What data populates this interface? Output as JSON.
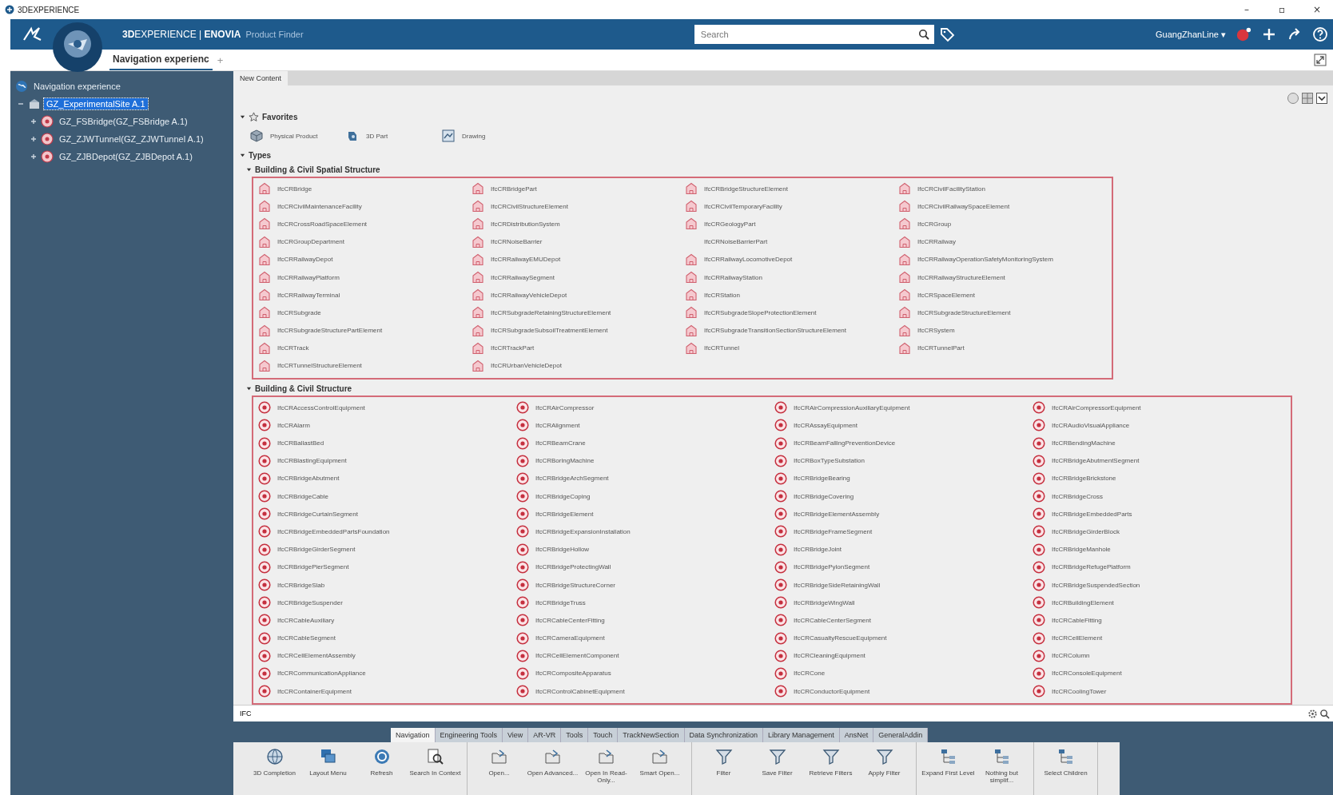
{
  "window": {
    "title": "3DEXPERIENCE",
    "controls": [
      "–",
      "▫",
      "×"
    ]
  },
  "header": {
    "brand": "**3D**EXPERIENCE | **ENOVIA**",
    "app": "Product Finder",
    "search": {
      "placeholder": "Search"
    },
    "user": "GuangZhanLine",
    "user_caret": "▾"
  },
  "tabs": [
    {
      "label": "Navigation experienc",
      "selected": true
    }
  ],
  "add_tab": "+",
  "tree": {
    "label": "Navigation experience",
    "children": [
      {
        "label": "GZ_ExperimentalSite A.1",
        "selected": true,
        "expanded": true,
        "children": [
          {
            "label": "GZ_FSBridge(GZ_FSBridge A.1)",
            "selected": false
          },
          {
            "label": "GZ_ZJWTunnel(GZ_ZJWTunnel A.1)",
            "selected": false
          },
          {
            "label": "GZ_ZJBDepot(GZ_ZJBDepot A.1)",
            "selected": false
          }
        ]
      }
    ]
  },
  "content_tab": "New Content",
  "favorites": {
    "title": "Favorites",
    "expanded": true,
    "items": [
      {
        "label": "Physical Product",
        "kind": "product"
      },
      {
        "label": "3D Part",
        "kind": "part"
      },
      {
        "label": "Drawing",
        "kind": "drawing"
      }
    ]
  },
  "types": {
    "title": "Types",
    "expanded": true,
    "sections": [
      {
        "title": "Building & Civil Spatial Structure",
        "kind": "spatial",
        "expanded": true,
        "items": [
          {
            "label": "IfcCRBridge",
            "icon": true
          },
          {
            "label": "IfcCRBridgePart",
            "icon": true
          },
          {
            "label": "IfcCRBridgeStructureElement",
            "icon": true
          },
          {
            "label": "IfcCRCivilFacilityStation",
            "icon": true
          },
          {
            "label": "IfcCRCivilMaintenanceFacility",
            "icon": true
          },
          {
            "label": "IfcCRCivilStructureElement",
            "icon": true
          },
          {
            "label": "IfcCRCivilTemporaryFacility",
            "icon": true
          },
          {
            "label": "IfcCRCivilRailwaySpaceElement",
            "icon": true
          },
          {
            "label": "IfcCRCrossRoadSpaceElement",
            "icon": true
          },
          {
            "label": "IfcCRDistributionSystem",
            "icon": true
          },
          {
            "label": "IfcCRGeologyPart",
            "icon": true
          },
          {
            "label": "IfcCRGroup",
            "icon": true
          },
          {
            "label": "IfcCRGroupDepartment",
            "icon": true
          },
          {
            "label": "IfcCRNoiseBarrier",
            "icon": true
          },
          {
            "label": "IfcCRNoiseBarrierPart",
            "icon": false
          },
          {
            "label": "IfcCRRailway",
            "icon": true
          },
          {
            "label": "IfcCRRailwayDepot",
            "icon": true
          },
          {
            "label": "IfcCRRailwayEMUDepot",
            "icon": true
          },
          {
            "label": "IfcCRRailwayLocomotiveDepot",
            "icon": true
          },
          {
            "label": "IfcCRRailwayOperationSafetyMonitoringSystem",
            "icon": true
          },
          {
            "label": "IfcCRRailwayPlatform",
            "icon": true
          },
          {
            "label": "IfcCRRailwaySegment",
            "icon": true
          },
          {
            "label": "IfcCRRailwayStation",
            "icon": true
          },
          {
            "label": "IfcCRRailwayStructureElement",
            "icon": true
          },
          {
            "label": "IfcCRRailwayTerminal",
            "icon": true
          },
          {
            "label": "IfcCRRailwayVehicleDepot",
            "icon": true
          },
          {
            "label": "IfcCRStation",
            "icon": true
          },
          {
            "label": "IfcCRSpaceElement",
            "icon": true
          },
          {
            "label": "IfcCRSubgrade",
            "icon": true
          },
          {
            "label": "IfcCRSubgradeRetainingStructureElement",
            "icon": true
          },
          {
            "label": "IfcCRSubgradeSlopeProtectionElement",
            "icon": true
          },
          {
            "label": "IfcCRSubgradeStructureElement",
            "icon": true
          },
          {
            "label": "IfcCRSubgradeStructurePartElement",
            "icon": true
          },
          {
            "label": "IfcCRSubgradeSubsoilTreatmentElement",
            "icon": true
          },
          {
            "label": "IfcCRSubgradeTransitionSectionStructureElement",
            "icon": true
          },
          {
            "label": "IfcCRSystem",
            "icon": true
          },
          {
            "label": "IfcCRTrack",
            "icon": true
          },
          {
            "label": "IfcCRTrackPart",
            "icon": true
          },
          {
            "label": "IfcCRTunnel",
            "icon": true
          },
          {
            "label": "IfcCRTunnelPart",
            "icon": true
          },
          {
            "label": "IfcCRTunnelStructureElement",
            "icon": true
          },
          {
            "label": "IfcCRUrbanVehicleDepot",
            "icon": true
          }
        ]
      },
      {
        "title": "Building & Civil Structure",
        "kind": "structure",
        "expanded": true,
        "items": [
          {
            "label": "IfcCRAccessControlEquipment",
            "icon": true
          },
          {
            "label": "IfcCRAirCompressor",
            "icon": true
          },
          {
            "label": "IfcCRAirCompressionAuxiliaryEquipment",
            "icon": true
          },
          {
            "label": "IfcCRAirCompressorEquipment",
            "icon": true
          },
          {
            "label": "IfcCRAlarm",
            "icon": true
          },
          {
            "label": "IfcCRAlignment",
            "icon": true
          },
          {
            "label": "IfcCRAssayEquipment",
            "icon": true
          },
          {
            "label": "IfcCRAudioVisualAppliance",
            "icon": true
          },
          {
            "label": "IfcCRBallastBed",
            "icon": true
          },
          {
            "label": "IfcCRBeamCrane",
            "icon": true
          },
          {
            "label": "IfcCRBeamFallingPreventionDevice",
            "icon": true
          },
          {
            "label": "IfcCRBendingMachine",
            "icon": true
          },
          {
            "label": "IfcCRBlastingEquipment",
            "icon": true
          },
          {
            "label": "IfcCRBoringMachine",
            "icon": true
          },
          {
            "label": "IfcCRBoxTypeSubstation",
            "icon": true
          },
          {
            "label": "IfcCRBridgeAbutmentSegment",
            "icon": true
          },
          {
            "label": "IfcCRBridgeAbutment",
            "icon": true
          },
          {
            "label": "IfcCRBridgeArchSegment",
            "icon": true
          },
          {
            "label": "IfcCRBridgeBearing",
            "icon": true
          },
          {
            "label": "IfcCRBridgeBrickstone",
            "icon": true
          },
          {
            "label": "IfcCRBridgeCable",
            "icon": true
          },
          {
            "label": "IfcCRBridgeCoping",
            "icon": true
          },
          {
            "label": "IfcCRBridgeCovering",
            "icon": true
          },
          {
            "label": "IfcCRBridgeCross",
            "icon": true
          },
          {
            "label": "IfcCRBridgeCurtainSegment",
            "icon": true
          },
          {
            "label": "IfcCRBridgeElement",
            "icon": true
          },
          {
            "label": "IfcCRBridgeElementAssembly",
            "icon": true
          },
          {
            "label": "IfcCRBridgeEmbeddedParts",
            "icon": true
          },
          {
            "label": "IfcCRBridgeEmbeddedPartsFoundation",
            "icon": true
          },
          {
            "label": "IfcCRBridgeExpansionInstallation",
            "icon": true
          },
          {
            "label": "IfcCRBridgeFrameSegment",
            "icon": true
          },
          {
            "label": "IfcCRBridgeGirderBlock",
            "icon": true
          },
          {
            "label": "IfcCRBridgeGirderSegment",
            "icon": true
          },
          {
            "label": "IfcCRBridgeHollow",
            "icon": true
          },
          {
            "label": "IfcCRBridgeJoint",
            "icon": true
          },
          {
            "label": "IfcCRBridgeManhole",
            "icon": true
          },
          {
            "label": "IfcCRBridgePierSegment",
            "icon": true
          },
          {
            "label": "IfcCRBridgeProtectingWall",
            "icon": true
          },
          {
            "label": "IfcCRBridgePylonSegment",
            "icon": true
          },
          {
            "label": "IfcCRBridgeRefugePlatform",
            "icon": true
          },
          {
            "label": "IfcCRBridgeSlab",
            "icon": true
          },
          {
            "label": "IfcCRBridgeStructureCorner",
            "icon": true
          },
          {
            "label": "IfcCRBridgeSideRetainingWall",
            "icon": true
          },
          {
            "label": "IfcCRBridgeSuspendedSection",
            "icon": true
          },
          {
            "label": "IfcCRBridgeSuspender",
            "icon": true
          },
          {
            "label": "IfcCRBridgeTruss",
            "icon": true
          },
          {
            "label": "IfcCRBridgeWingWall",
            "icon": true
          },
          {
            "label": "IfcCRBuildingElement",
            "icon": true
          },
          {
            "label": "IfcCRCableAuxiliary",
            "icon": true
          },
          {
            "label": "IfcCRCableCenterFitting",
            "icon": true
          },
          {
            "label": "IfcCRCableCenterSegment",
            "icon": true
          },
          {
            "label": "IfcCRCableFitting",
            "icon": true
          },
          {
            "label": "IfcCRCableSegment",
            "icon": true
          },
          {
            "label": "IfcCRCameraEquipment",
            "icon": true
          },
          {
            "label": "IfcCRCasualtyRescueEquipment",
            "icon": true
          },
          {
            "label": "IfcCRCellElement",
            "icon": true
          },
          {
            "label": "IfcCRCellElementAssembly",
            "icon": true
          },
          {
            "label": "IfcCRCellElementComponent",
            "icon": true
          },
          {
            "label": "IfcCRCleaningEquipment",
            "icon": true
          },
          {
            "label": "IfcCRColumn",
            "icon": true
          },
          {
            "label": "IfcCRCommunicationAppliance",
            "icon": true
          },
          {
            "label": "IfcCRCompositeApparatus",
            "icon": true
          },
          {
            "label": "IfcCRCone",
            "icon": true
          },
          {
            "label": "IfcCRConsoleEquipment",
            "icon": true
          },
          {
            "label": "IfcCRContainerEquipment",
            "icon": true
          },
          {
            "label": "IfcCRControlCabinetEquipment",
            "icon": true
          },
          {
            "label": "IfcCRConductorEquipment",
            "icon": true
          },
          {
            "label": "IfcCRCoolingTower",
            "icon": true
          }
        ]
      }
    ]
  },
  "filter": {
    "value": "IFC"
  },
  "ribbon": {
    "tabs": [
      {
        "label": "Navigation",
        "selected": true
      },
      {
        "label": "Engineering Tools",
        "selected": false
      },
      {
        "label": "View",
        "selected": false
      },
      {
        "label": "AR-VR",
        "selected": false
      },
      {
        "label": "Tools",
        "selected": false
      },
      {
        "label": "Touch",
        "selected": false
      },
      {
        "label": "TrackNewSection",
        "selected": false
      },
      {
        "label": "Data Synchronization",
        "selected": false
      },
      {
        "label": "Library Management",
        "selected": false
      },
      {
        "label": "AnsNet",
        "selected": false
      },
      {
        "label": "GeneralAddin",
        "selected": false
      }
    ],
    "groups": [
      {
        "buttons": [
          {
            "label": "3D Completion",
            "kind": "globe"
          },
          {
            "label": "Layout Menu",
            "kind": "stack"
          },
          {
            "label": "Refresh",
            "kind": "refresh"
          },
          {
            "label": "Search In Context",
            "kind": "search"
          }
        ]
      },
      {
        "buttons": [
          {
            "label": "Open...",
            "kind": "open"
          },
          {
            "label": "Open Advanced...",
            "kind": "open"
          },
          {
            "label": "Open In Read-Only...",
            "kind": "open"
          },
          {
            "label": "Smart Open...",
            "kind": "open"
          }
        ]
      },
      {
        "buttons": [
          {
            "label": "Filter",
            "kind": "filter"
          },
          {
            "label": "Save Filter",
            "kind": "filter"
          },
          {
            "label": "Retrieve Filters",
            "kind": "filter"
          },
          {
            "label": "Apply Filter",
            "kind": "filter"
          }
        ]
      },
      {
        "buttons": [
          {
            "label": "Expand First Level",
            "kind": "tree"
          },
          {
            "label": "Nothing but simplif...",
            "kind": "tree"
          }
        ]
      },
      {
        "buttons": [
          {
            "label": "Select Children",
            "kind": "tree"
          }
        ]
      }
    ]
  }
}
